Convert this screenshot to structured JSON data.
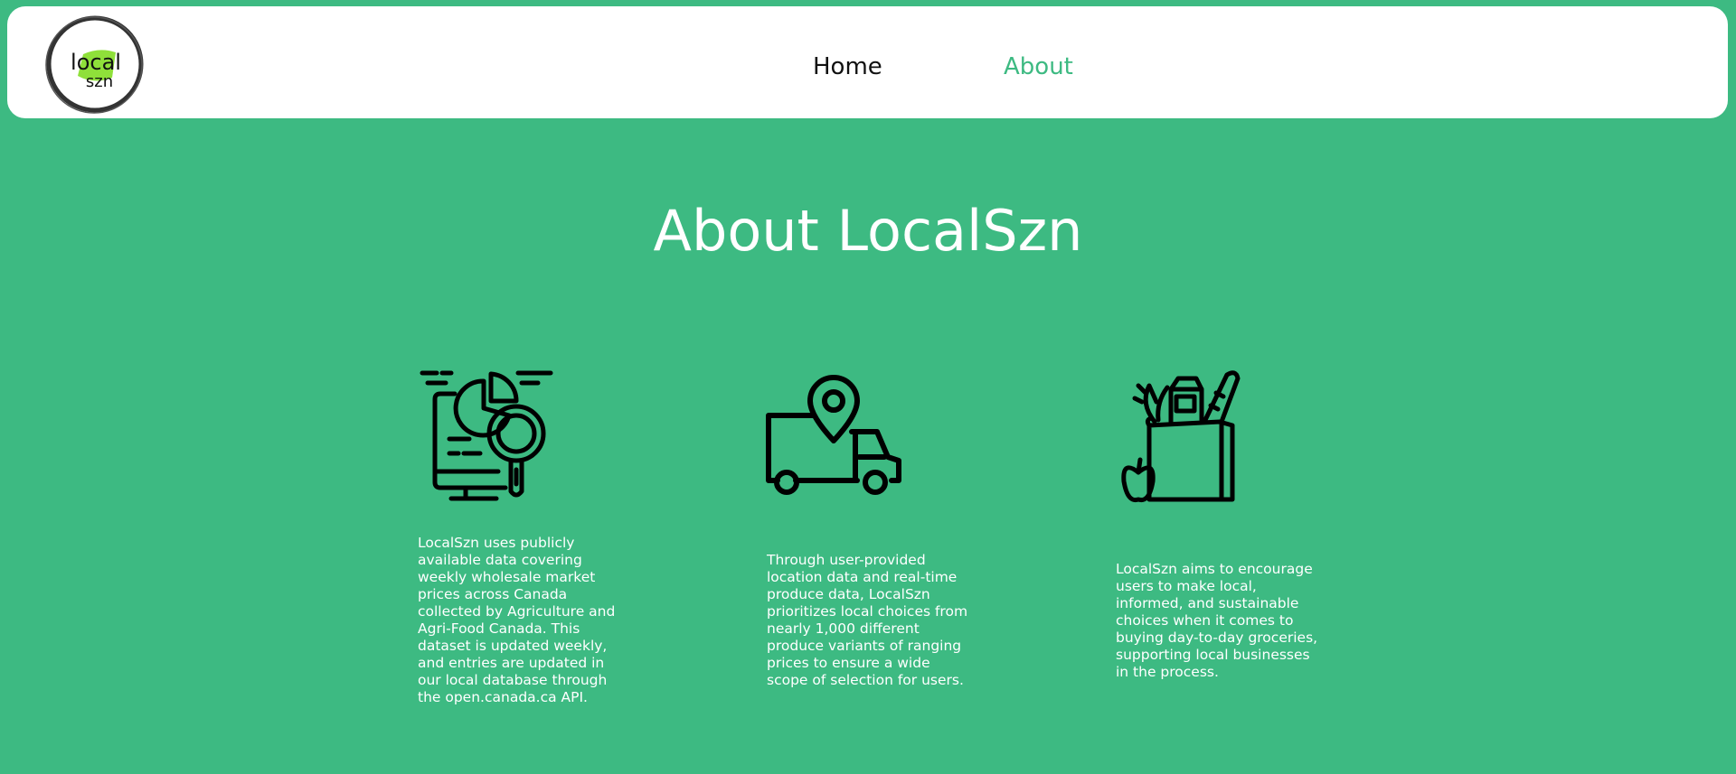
{
  "brand": {
    "logo_line1": "local",
    "logo_line2": "szn"
  },
  "nav": {
    "home_label": "Home",
    "about_label": "About",
    "active": "About"
  },
  "page_title": "About LocalSzn",
  "features": [
    {
      "icon": "data-analytics-icon",
      "text": "LocalSzn uses publicly available data covering weekly wholesale market prices across Canada collected by Agriculture and Agri-Food Canada. This dataset is updated weekly, and entries are updated in our local database through the open.canada.ca API."
    },
    {
      "icon": "delivery-truck-location-icon",
      "text": "Through user-provided location data and real-time produce data, LocalSzn prioritizes local choices from nearly 1,000 different produce variants of ranging prices to ensure a wide scope of selection for users."
    },
    {
      "icon": "grocery-bag-icon",
      "text": "LocalSzn aims to encourage users to make local, informed, and sustainable choices when it comes to buying day-to-day groceries, supporting local businesses in the process."
    }
  ],
  "colors": {
    "background": "#3dba82",
    "navbar": "#ffffff",
    "accent": "#3dba82",
    "logo_leaf": "#8fe03a",
    "icon": "#000000"
  }
}
